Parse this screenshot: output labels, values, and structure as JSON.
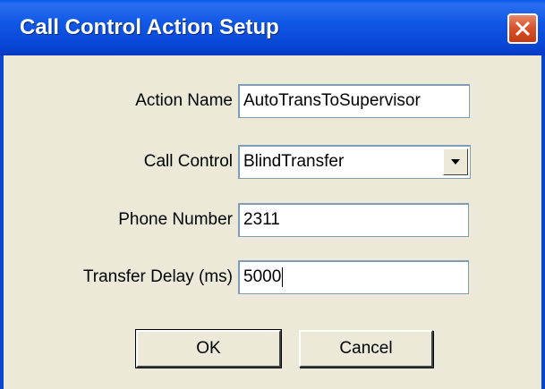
{
  "window": {
    "title": "Call Control Action Setup",
    "close_icon": "close-icon"
  },
  "form": {
    "action_name": {
      "label": "Action Name",
      "value": "AutoTransToSupervisor"
    },
    "call_control": {
      "label": "Call Control",
      "value": "BlindTransfer",
      "arrow_icon": "dropdown-arrow-icon"
    },
    "phone_number": {
      "label": "Phone Number",
      "value": "2311"
    },
    "transfer_delay": {
      "label": "Transfer Delay (ms)",
      "value": "5000"
    }
  },
  "buttons": {
    "ok_label": "OK",
    "cancel_label": "Cancel"
  },
  "colors": {
    "titlebar": "#0845d3",
    "close_button": "#d9542b",
    "dialog_background": "#ece9d8",
    "field_border": "#7f9db9"
  }
}
